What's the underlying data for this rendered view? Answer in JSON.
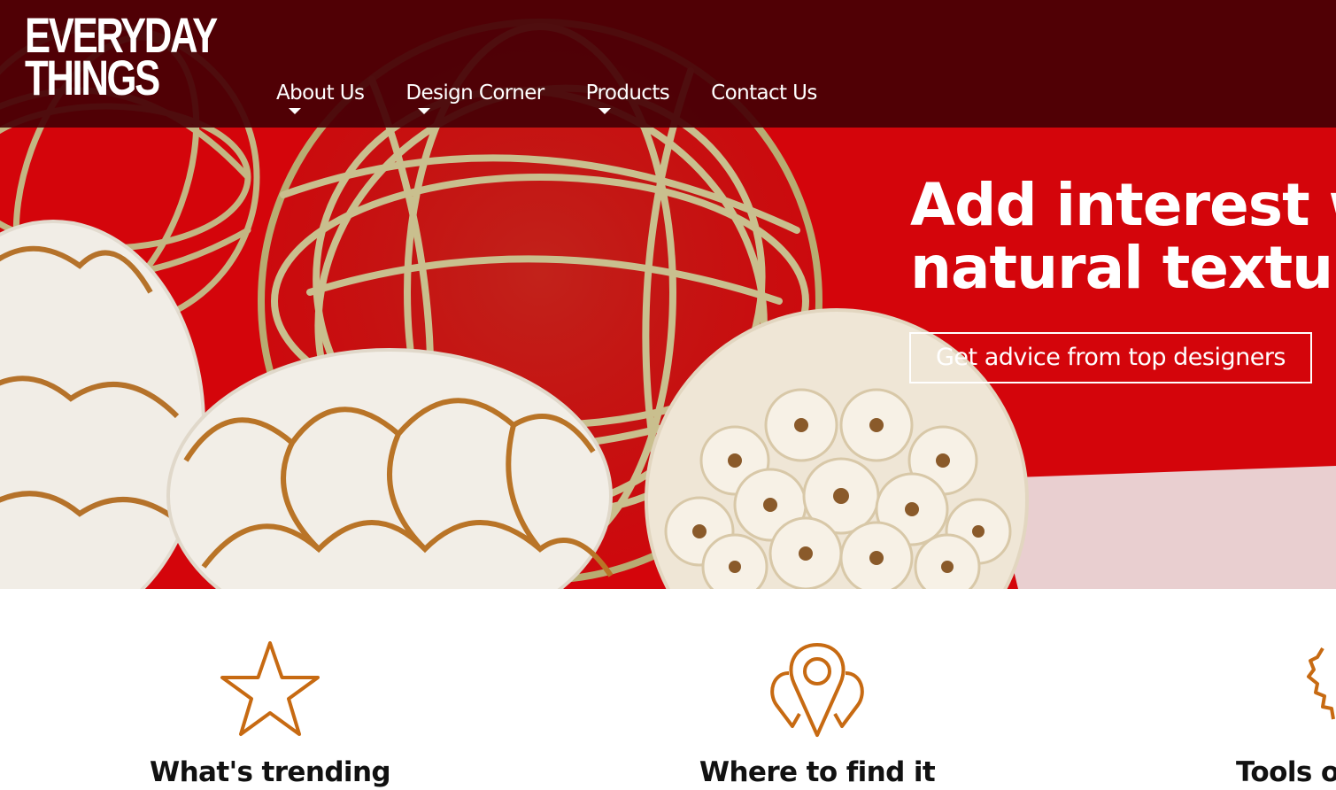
{
  "brand": {
    "logo_line1": "EVERYDAY",
    "logo_line2": "THINGS"
  },
  "nav": {
    "items": [
      {
        "label": "About Us",
        "has_dropdown": true
      },
      {
        "label": "Design Corner",
        "has_dropdown": true
      },
      {
        "label": "Products",
        "has_dropdown": true
      },
      {
        "label": "Contact Us",
        "has_dropdown": false
      }
    ]
  },
  "hero": {
    "headline_line1": "Add interest w",
    "headline_line2": "natural textur",
    "cta_label": "Get advice from top designers"
  },
  "features": [
    {
      "title": "What's trending",
      "icon": "star-icon"
    },
    {
      "title": "Where to find it",
      "icon": "map-pin-icon"
    },
    {
      "title": "Tools o",
      "icon": "gear-icon"
    }
  ],
  "colors": {
    "header_bg": "#460005",
    "hero_red": "#d4050b",
    "icon_orange": "#c76a12",
    "text_dark": "#111111"
  }
}
